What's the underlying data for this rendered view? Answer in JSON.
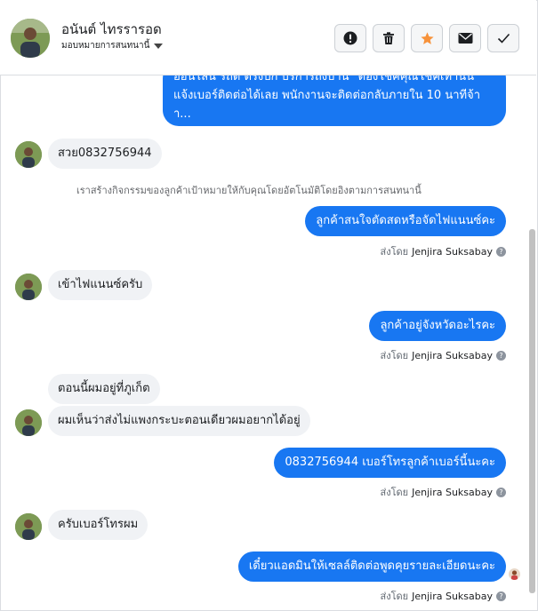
{
  "header": {
    "name": "อนันต์ ไทรรารอด",
    "assign_label": "มอบหมายการสนทนานี้"
  },
  "toolbar": {
    "buttons": [
      {
        "icon": "alert-icon"
      },
      {
        "icon": "trash-icon"
      },
      {
        "icon": "star-icon",
        "color": "#f7923a"
      },
      {
        "icon": "mail-icon"
      },
      {
        "icon": "check-icon"
      }
    ]
  },
  "thread": {
    "first_message_lines": [
      "ออนไลน์ รถดี ตรงปก บริการถึงบ้าน \"ต้องโชคคุณโชคเท่านั้น\"",
      "แจ้งเบอร์ติดต่อได้เลย พนักงานจะติดต่อกลับภายใน 10 นาทีจ้า",
      "า..."
    ],
    "msg_in_1": "สวย0832756944",
    "system_note": "เราสร้างกิจกรรมของลูกค้าเป้าหมายให้กับคุณโดยอัตโนมัติโดยอิงตามการสนทนานี้",
    "msg_out_1": "ลูกค้าสนใจตัดสดหรือจัดไฟแนนซ์คะ",
    "msg_in_2": "เข้าไฟแนนซ์ครับ",
    "msg_out_2": "ลูกค้าอยู่จังหวัดอะไรคะ",
    "msg_in_3": "ตอนนี้ผมอยู่ที่ภูเก็ต",
    "msg_in_4": "ผมเห็นว่าส่งไม่แพงกระบะตอนเดียวผมอยากได้อยู่",
    "msg_out_3": "0832756944 เบอร์โทรลูกค้าเบอร์นี้นะคะ",
    "msg_in_5": "ครับเบอร์โทรผม",
    "msg_out_4": "เดี๋ยวแอดมินให้เซลล์ติดต่อพูดคุยรายละเอียดนะคะ",
    "sent_by_prefix": "ส่งโดย",
    "sent_by_name": "Jenjira Suksabay"
  },
  "colors": {
    "outgoing_bubble": "#1877f2",
    "incoming_bubble": "#f0f2f5"
  }
}
